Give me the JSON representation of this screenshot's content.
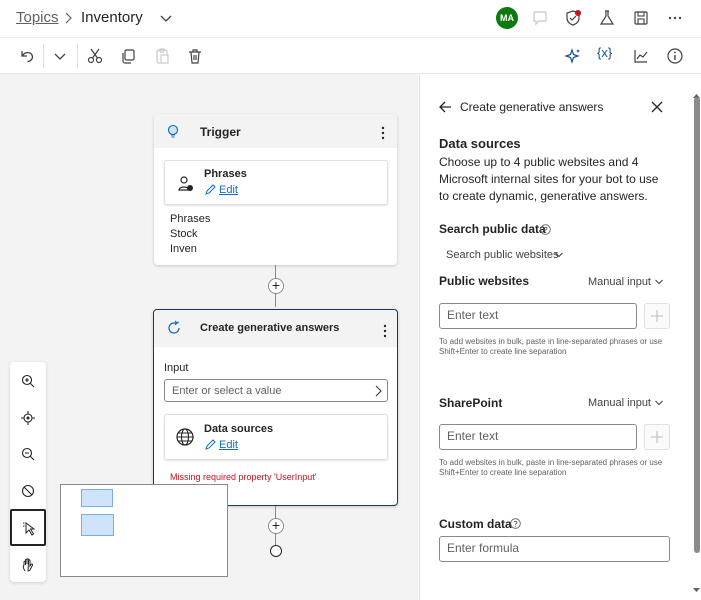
{
  "breadcrumb": {
    "root": "Topics",
    "current": "Inventory"
  },
  "header": {
    "avatar_initials": "MA",
    "avatar_color": "#0e7a0d"
  },
  "toolbar": {
    "icons": [
      "undo-icon",
      "chevron-down-icon",
      "cut-icon",
      "copy-icon",
      "paste-icon",
      "delete-icon",
      "sparkle-icon",
      "variables-icon",
      "analytics-icon",
      "info-icon"
    ],
    "variables_glyph": "{x}"
  },
  "trigger_node": {
    "title": "Trigger",
    "phrases_card_title": "Phrases",
    "edit_label": "Edit",
    "phrases_heading": "Phrases",
    "phrases": [
      "Stock",
      "Inven"
    ]
  },
  "gen_node": {
    "title": "Create generative answers",
    "input_label": "Input",
    "input_placeholder": "Enter or select a value",
    "data_sources_title": "Data sources",
    "edit_label": "Edit",
    "error": "Missing required property 'UserInput'"
  },
  "panel": {
    "title": "Create generative answers",
    "data_sources_heading": "Data sources",
    "data_sources_desc": "Choose up to 4 public websites and 4 Microsoft internal sites for your bot to use to create dynamic, generative answers.",
    "search_public_data_label": "Search public data",
    "search_public_websites_dropdown": "Search public websites",
    "public_websites_label": "Public websites",
    "public_websites_mode": "Manual input",
    "public_websites_placeholder": "Enter text",
    "public_websites_help": "To add websites in bulk, paste in line-separated phrases or use Shift+Enter to create line separation",
    "sharepoint_label": "SharePoint",
    "sharepoint_mode": "Manual input",
    "sharepoint_placeholder": "Enter text",
    "sharepoint_help": "To add websites in bulk, paste in line-separated phrases or use Shift+Enter to create line separation",
    "custom_data_label": "Custom data",
    "custom_data_placeholder": "Enter formula"
  },
  "colors": {
    "accent": "#0f6cbd",
    "error": "#c50f1f",
    "selected_border": "#1b3a57"
  }
}
